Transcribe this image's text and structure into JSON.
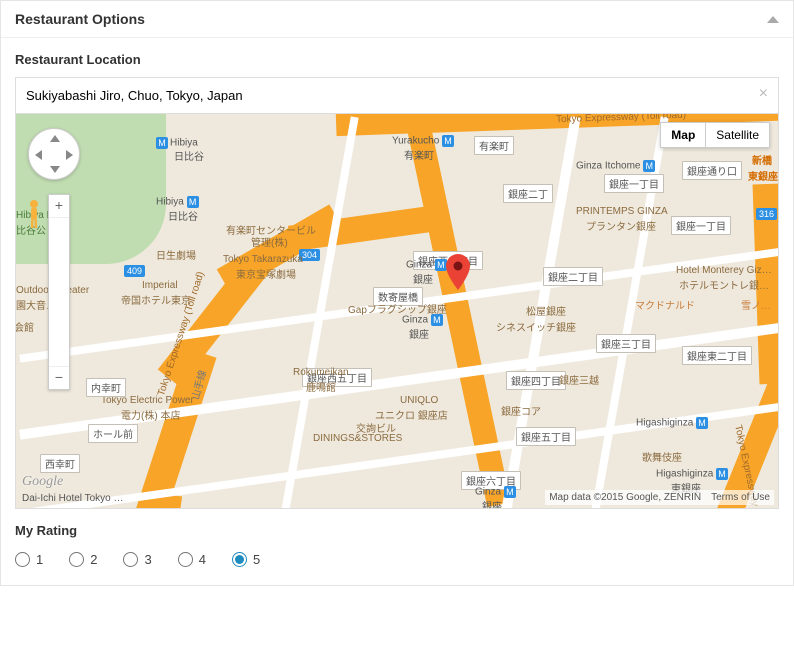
{
  "panel": {
    "title": "Restaurant Options"
  },
  "location": {
    "label": "Restaurant Location",
    "value": "Sukiyabashi Jiro, Chuo, Tokyo, Japan",
    "clear": "×"
  },
  "map": {
    "type_map": "Map",
    "type_satellite": "Satellite",
    "attribution": "Map data ©2015 Google, ZENRIN",
    "terms": "Terms of Use",
    "logo": "Google",
    "zoom_in": "+",
    "zoom_out": "−",
    "bottom_label": "Dai-Ichi Hotel Tokyo …",
    "expressway": "Tokyo Expressway (Toll road)",
    "labels": {
      "hibiya": "Hibiya",
      "hibiya2": "Hibiya",
      "hibiya_jp": "日比谷",
      "yurakucho": "Yurakucho",
      "yurakucho_jp": "有楽町",
      "yurakucho_box": "有楽町",
      "ginza_itchome": "Ginza Itchome",
      "ginza_itchome_jp": "銀座一丁目",
      "shimbashi": "新橋",
      "higashi_ginza_jp": "東銀座",
      "ginza1": "Ginza",
      "ginza1_jp": "銀座",
      "ginza2": "Ginza",
      "ginza2_jp": "銀座",
      "ginza3": "Ginza",
      "ginza3_jp": "銀座",
      "higashiginza": "Higashiginza",
      "higashiginza_jp": "東銀座",
      "hibiya_kouen": "Hibiya Ko…",
      "hibiya_kouen_jp": "比谷公",
      "uchisaiwai": "内幸町",
      "nishi_cho": "西幸町",
      "n304": "304",
      "n409": "409",
      "n316": "316"
    },
    "pois": {
      "printemps": "PRINTEMPS GINZA",
      "printemps_jp": "プランタン銀座",
      "gap": "Gapフラグシップ銀座",
      "cine": "シネスイッチ銀座",
      "matsuya": "松屋銀座",
      "mcdonald": "マクドナルド",
      "yukino": "雪ノ…",
      "mitsukoshi": "銀座三越",
      "core": "銀座コア",
      "uniqlo": "UNIQLO",
      "uniqlo_jp": "ユニクロ 銀座店",
      "kotsu": "交詢ビル",
      "dinings": "DININGS&STORES",
      "kabukiza": "歌舞伎座",
      "monterey": "Hotel Monterey Giz…",
      "monterey_jp": "ホテルモントレ銀…",
      "rokumeikan": "Rokumeikan",
      "rokumeikan_jp": "鹿鳴館",
      "takarazuka": "Tokyo Takarazuka",
      "takarazuka_jp": "東京宝塚劇場",
      "tepower": "Tokyo Electric Power",
      "tepower_jp": "電力(株) 本店",
      "imperial": "Imperial",
      "imperial_jp": "帝国ホテル東京",
      "outdoor": "Outdoor Theater",
      "outdoor_jp": "園大音…堂",
      "yurakucho_center": "有楽町センタービル",
      "yurakucho_center2": "管理(株)",
      "hibiya_theater": "日生劇場",
      "yamate": "山手線",
      "kaikan": "会館",
      "hole_mae": "ホール前",
      "ginza_dori": "銀座通り口",
      "sukiyabashi": "数寄屋橋",
      "nishi3": "銀座西三丁目",
      "nishi5": "銀座西五丁目",
      "chome1": "銀座一丁目",
      "chome2": "銀座二丁",
      "chome2b": "銀座二丁目",
      "chome3": "銀座三丁目",
      "chome4": "銀座四丁目",
      "chome5": "銀座五丁目",
      "chome6": "銀座六丁目",
      "higashi2": "銀座東二丁目"
    }
  },
  "rating": {
    "label": "My Rating",
    "options": [
      "1",
      "2",
      "3",
      "4",
      "5"
    ],
    "selected": "5"
  }
}
